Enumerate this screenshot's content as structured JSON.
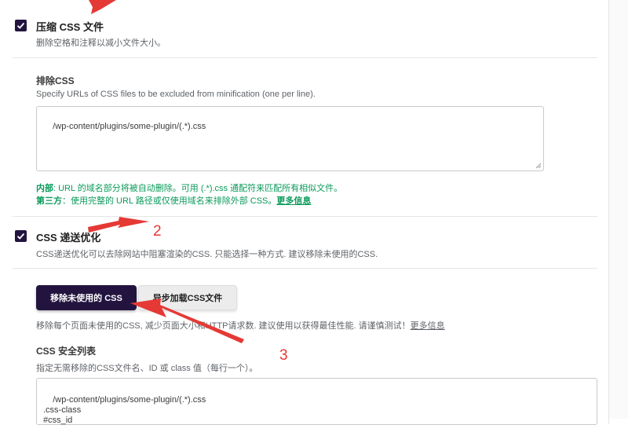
{
  "minify_css": {
    "title": "压缩 CSS 文件",
    "desc": "删除空格和注释以减小文件大小。",
    "checked": true
  },
  "exclude_css": {
    "label": "排除CSS",
    "desc": "Specify URLs of CSS files to be excluded from minification (one per line).",
    "value": "/wp-content/plugins/some-plugin/(.*).css",
    "note_internal_label": "内部",
    "note_internal_text": ": URL 的域名部分将被自动删除。可用 (.*).css 通配符来匹配所有相似文件。",
    "note_third_label": "第三方",
    "note_third_text": "：使用完整的 URL 路径或仅使用域名来排除外部 CSS。",
    "note_more_link": "更多信息"
  },
  "css_delivery": {
    "title": "CSS 递送优化",
    "desc": "CSS递送优化可以去除网站中阻塞渲染的CSS. 只能选择一种方式. 建议移除未使用的CSS.",
    "checked": true,
    "btn_remove_unused": "移除未使用的 CSS",
    "btn_async_load": "异步加载CSS文件",
    "help_text": "移除每个页面未使用的CSS, 减少页面大小和HTTP请求数. 建议使用以获得最佳性能. 请谨慎测试！",
    "help_more_link": "更多信息"
  },
  "safelist": {
    "label": "CSS 安全列表",
    "desc": "指定无需移除的CSS文件名、ID 或 class 值（每行一个）。",
    "value": "/wp-content/plugins/some-plugin/(.*).css\n.css-class\n#css_id"
  },
  "annotations": {
    "num2": "2",
    "num3": "3",
    "color": "#e53935"
  },
  "colors": {
    "accent": "#22143f",
    "note_green": "#0a9a5a"
  }
}
